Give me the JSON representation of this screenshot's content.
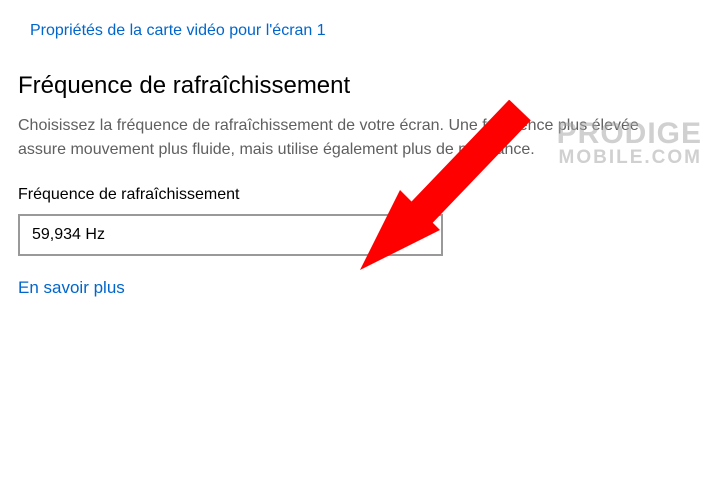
{
  "header": {
    "properties_link": "Propriétés de la carte vidéo pour l'écran 1"
  },
  "section": {
    "title": "Fréquence de rafraîchissement",
    "description": "Choisissez la fréquence de rafraîchissement de votre écran. Une fréquence plus élevée assure mouvement plus fluide, mais utilise également plus de puissance."
  },
  "field": {
    "label": "Fréquence de rafraîchissement",
    "selected": "59,934 Hz"
  },
  "learn_more": "En savoir plus",
  "watermark": {
    "line1": "PRODIGE",
    "line2": "MOBILE.COM"
  }
}
